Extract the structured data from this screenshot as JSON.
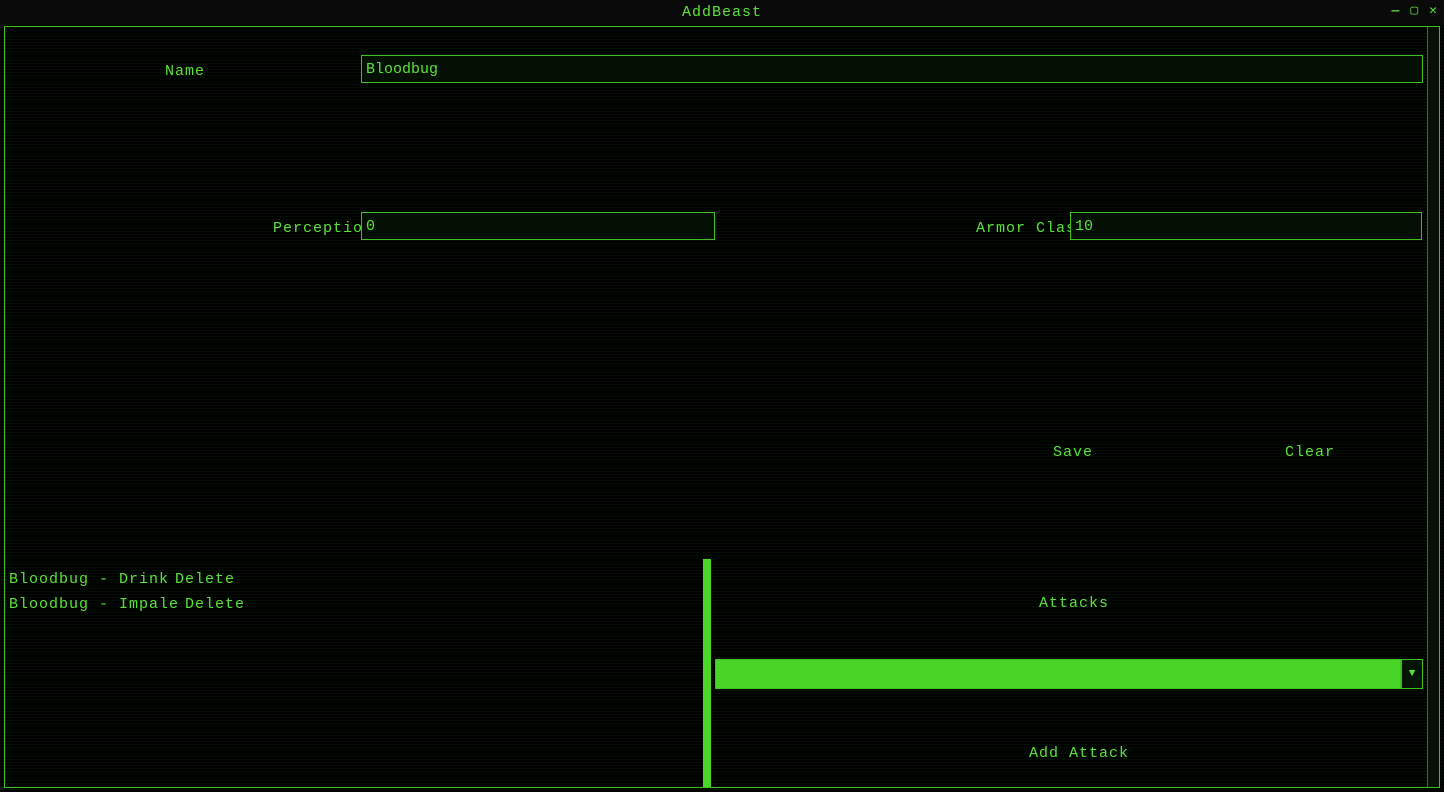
{
  "window": {
    "title": "AddBeast"
  },
  "form": {
    "name_label": "Name",
    "name_value": "Bloodbug",
    "perception_label": "Perception",
    "perception_value": "0",
    "armorclass_label": "Armor Class",
    "armorclass_value": "10"
  },
  "buttons": {
    "save": "Save",
    "clear": "Clear",
    "add_attack": "Add Attack"
  },
  "attack_list": [
    {
      "label": "Bloodbug - Drink",
      "delete": "Delete"
    },
    {
      "label": "Bloodbug - Impale",
      "delete": "Delete"
    }
  ],
  "panels": {
    "attacks_heading": "Attacks"
  },
  "combo": {
    "selected": ""
  }
}
